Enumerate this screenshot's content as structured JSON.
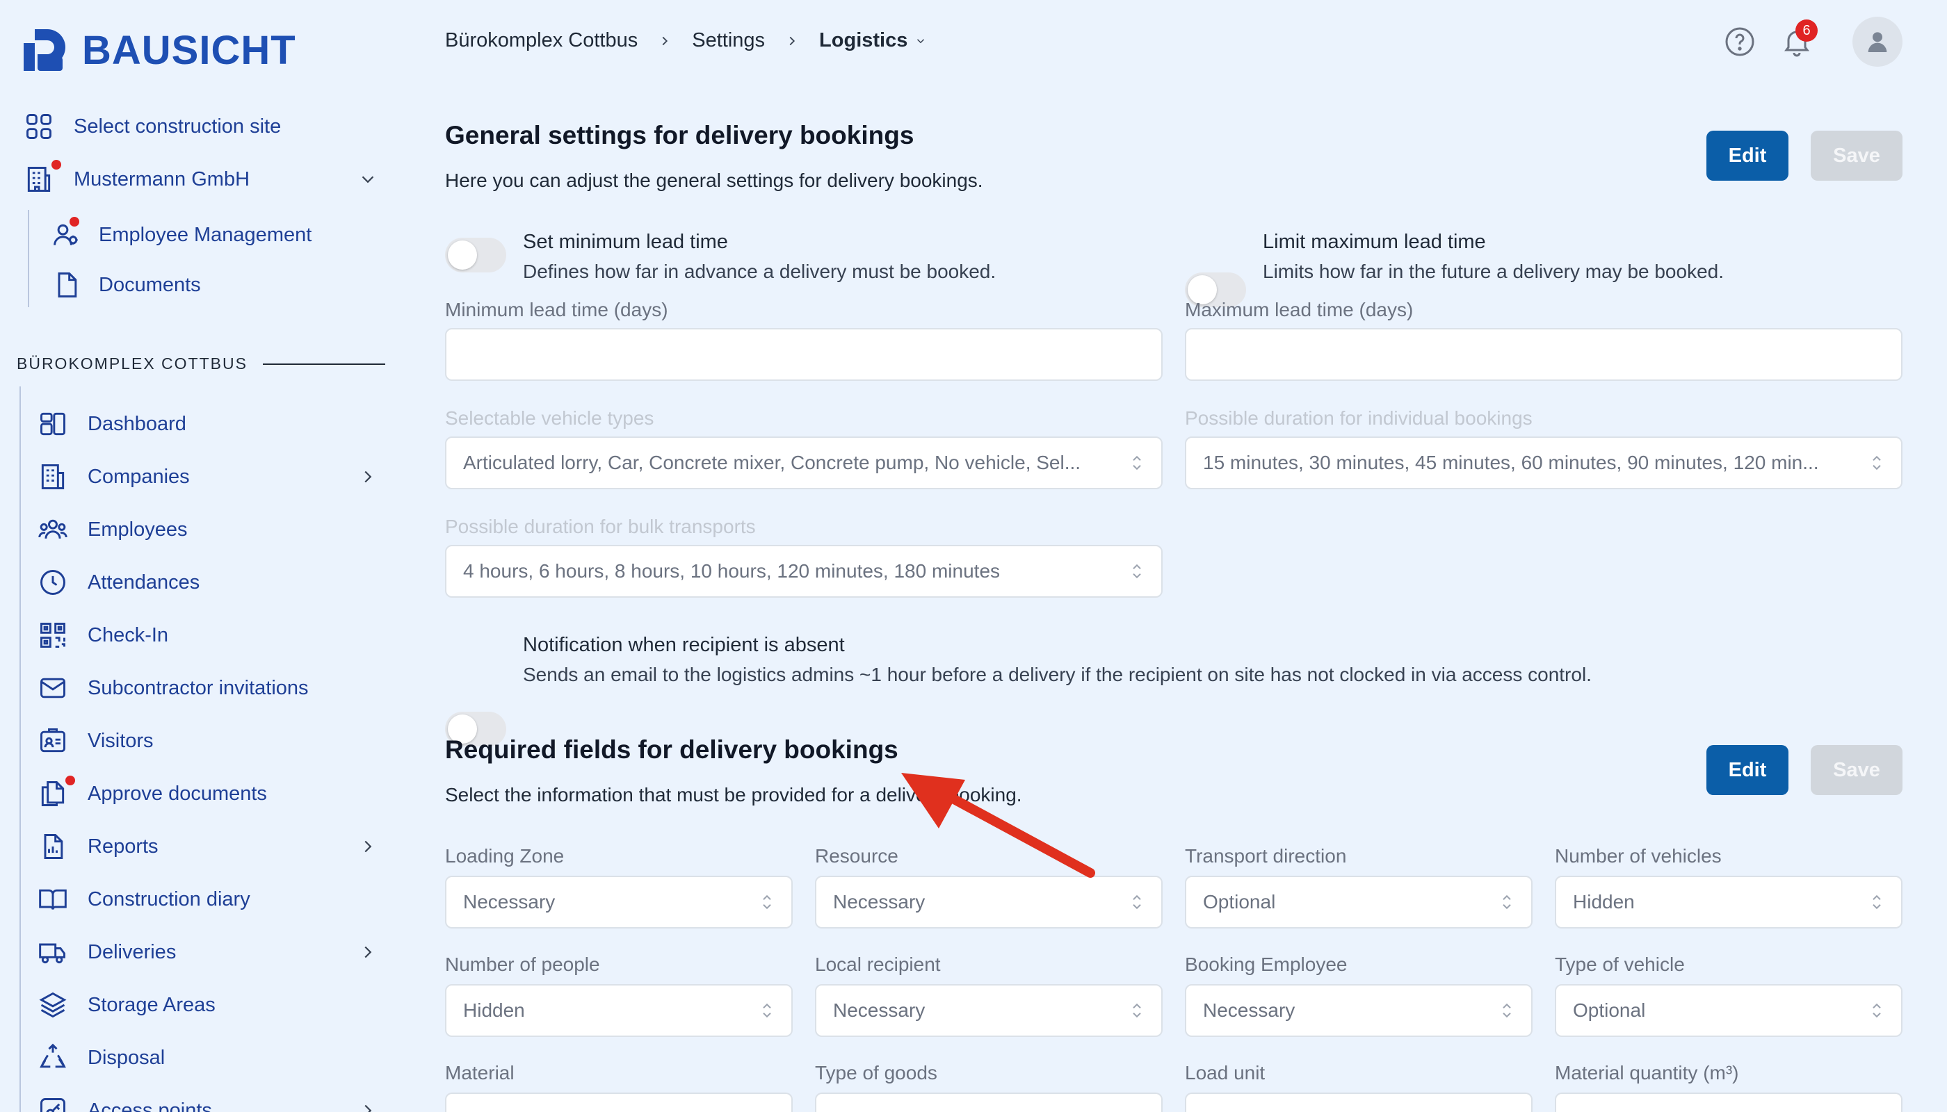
{
  "brand": {
    "name": "BAUSICHT",
    "color": "#1e4fb3"
  },
  "sidebar": {
    "select_site": "Select construction site",
    "company": "Mustermann GmbH",
    "company_sub": [
      "Employee Management",
      "Documents"
    ],
    "section_label": "BÜROKOMPLEX COTTBUS",
    "items": [
      {
        "label": "Dashboard",
        "icon": "dashboard-icon"
      },
      {
        "label": "Companies",
        "icon": "building-icon"
      },
      {
        "label": "Employees",
        "icon": "users-icon"
      },
      {
        "label": "Attendances",
        "icon": "clock-icon"
      },
      {
        "label": "Check-In",
        "icon": "qr-code-icon"
      },
      {
        "label": "Subcontractor invitations",
        "icon": "envelope-icon"
      },
      {
        "label": "Visitors",
        "icon": "id-card-icon"
      },
      {
        "label": "Approve documents",
        "icon": "documents-icon"
      },
      {
        "label": "Reports",
        "icon": "report-icon"
      },
      {
        "label": "Construction diary",
        "icon": "book-icon"
      },
      {
        "label": "Deliveries",
        "icon": "truck-icon"
      },
      {
        "label": "Storage Areas",
        "icon": "layers-icon"
      },
      {
        "label": "Disposal",
        "icon": "recycle-icon"
      },
      {
        "label": "Access points",
        "icon": "key-icon"
      }
    ]
  },
  "breadcrumb": [
    "Bürokomplex Cottbus",
    "Settings",
    "Logistics"
  ],
  "header": {
    "notification_count": "6"
  },
  "general": {
    "title": "General settings for delivery bookings",
    "description": "Here you can adjust the general settings for delivery bookings.",
    "edit_label": "Edit",
    "save_label": "Save",
    "min_toggle": {
      "title": "Set minimum lead time",
      "sub": "Defines how far in advance a delivery must be booked.",
      "on": false
    },
    "max_toggle": {
      "title": "Limit maximum lead time",
      "sub": "Limits how far in the future a delivery may be booked.",
      "on": false
    },
    "min_label": "Minimum lead time (days)",
    "max_label": "Maximum lead time (days)",
    "min_value": "",
    "max_value": "",
    "vehicle_label": "Selectable vehicle types",
    "vehicle_value": "Articulated lorry, Car, Concrete mixer, Concrete pump, No vehicle, Sel...",
    "duration_label": "Possible duration for individual bookings",
    "duration_value": "15 minutes, 30 minutes, 45 minutes, 60 minutes, 90 minutes, 120 min...",
    "bulk_label": "Possible duration for bulk transports",
    "bulk_value": "4 hours, 6 hours, 8 hours, 10 hours, 120 minutes, 180 minutes",
    "absent_toggle": {
      "title": "Notification when recipient is absent",
      "sub": "Sends an email to the logistics admins ~1 hour before a delivery if the recipient on site has not clocked in via access control.",
      "on": false
    }
  },
  "required": {
    "title": "Required fields for delivery bookings",
    "description": "Select the information that must be provided for a delivery booking.",
    "edit_label": "Edit",
    "save_label": "Save",
    "fields": [
      {
        "label": "Loading Zone",
        "value": "Necessary"
      },
      {
        "label": "Resource",
        "value": "Necessary"
      },
      {
        "label": "Transport direction",
        "value": "Optional"
      },
      {
        "label": "Number of vehicles",
        "value": "Hidden"
      },
      {
        "label": "Number of people",
        "value": "Hidden"
      },
      {
        "label": "Local recipient",
        "value": "Necessary"
      },
      {
        "label": "Booking Employee",
        "value": "Necessary"
      },
      {
        "label": "Type of vehicle",
        "value": "Optional"
      },
      {
        "label": "Material",
        "value": ""
      },
      {
        "label": "Type of goods",
        "value": ""
      },
      {
        "label": "Load unit",
        "value": ""
      },
      {
        "label": "Material quantity (m³)",
        "value": ""
      }
    ]
  },
  "colors": {
    "accent": "#0b5ea8",
    "sidebar_text": "#1e3f96",
    "alert": "#e02424",
    "annotation_arrow": "#e0301e"
  }
}
